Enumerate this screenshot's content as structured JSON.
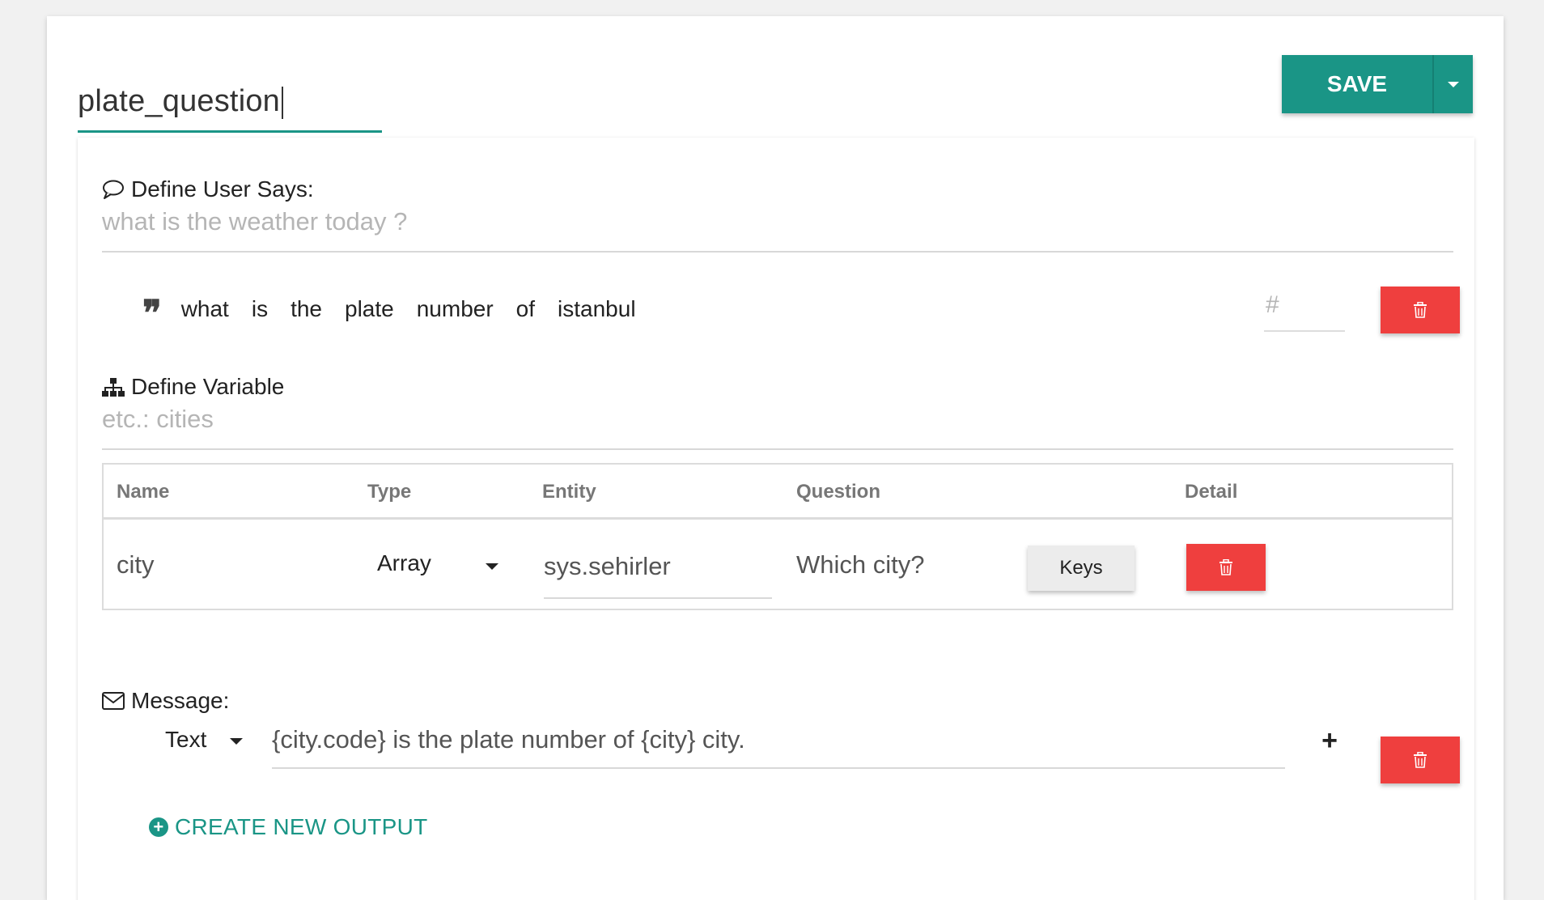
{
  "intent": {
    "name_value": "plate_question"
  },
  "toolbar": {
    "save_label": "SAVE"
  },
  "user_says": {
    "label": "Define User Says:",
    "placeholder": "what is the weather today ?",
    "utterance_words": [
      "what",
      "is",
      "the",
      "plate",
      "number",
      "of",
      "istanbul"
    ],
    "hash_placeholder": "#"
  },
  "variables": {
    "label": "Define Variable",
    "placeholder": "etc.: cities",
    "headers": {
      "name": "Name",
      "type": "Type",
      "entity": "Entity",
      "question": "Question",
      "detail": "Detail"
    },
    "rows": [
      {
        "name": "city",
        "type": "Array",
        "entity": "sys.sehirler",
        "question": "Which city?",
        "detail_button": "Keys"
      }
    ]
  },
  "message": {
    "label": "Message:",
    "type": "Text",
    "value": "{city.code} is the plate number of {city} city.",
    "add_symbol": "+"
  },
  "create_output": {
    "label": "CREATE NEW OUTPUT"
  },
  "colors": {
    "accent": "#1a9586",
    "danger": "#ef3f3e",
    "background": "#f1f1f1"
  }
}
